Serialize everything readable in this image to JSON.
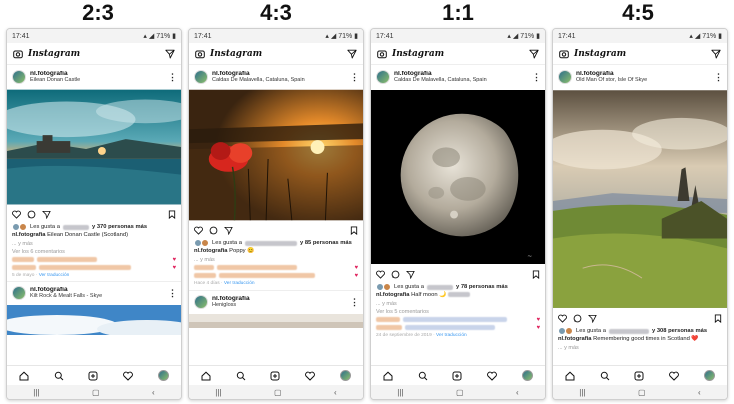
{
  "labels": [
    "2:3",
    "4:3",
    "1:1",
    "4:5"
  ],
  "brand": "Instagram",
  "colors": {
    "heart": "#e0245e",
    "link": "#3897f0",
    "divider": "#e6e6e6"
  },
  "phones": [
    {
      "status": {
        "time": "17:41",
        "battery": "71%"
      },
      "post": {
        "user": "nl.fotografia",
        "location": "Eilean Donan Castle",
        "likes_prefix": "Les gusta a",
        "likes_suffix": "y 370 personas más",
        "caption": "Eilean Donan Castle (Scotland)",
        "more": "... y más",
        "comments_link": "Ver los 6 comentarios",
        "meta": "5 de mayo ·",
        "meta_link": "Ver traducción"
      },
      "next": {
        "user": "nl.fotografia",
        "location": "Kilt Rock & Mealt Falls - Skye"
      }
    },
    {
      "status": {
        "time": "17:41",
        "battery": "71%"
      },
      "post": {
        "user": "nl.fotografia",
        "location": "Caldas De Malavella, Cataluna, Spain",
        "likes_prefix": "Les gusta a",
        "likes_suffix": "y 85 personas más",
        "caption": "Poppy",
        "more": "... y más",
        "meta": "Hace 4 días ·",
        "meta_link": "Ver traducción"
      },
      "next": {
        "user": "nl.fotografia",
        "location": "Henigloss"
      }
    },
    {
      "status": {
        "time": "17:41",
        "battery": "71%"
      },
      "post": {
        "user": "nl.fotografia",
        "location": "Caldas De Malavella, Cataluna, Spain",
        "likes_prefix": "Les gusta a",
        "likes_suffix": "y 78 personas más",
        "caption": "Half moon 🌙",
        "more": "... y más",
        "comments_link": "Ver los 5 comentarios",
        "meta": "24 de septiembre de 2019 ·",
        "meta_link": "Ver traducción"
      }
    },
    {
      "status": {
        "time": "17:41",
        "battery": "71%"
      },
      "post": {
        "user": "nl.fotografia",
        "location": "Old Man Of stor, Isle Of Skye",
        "likes_prefix": "Les gusta a",
        "likes_suffix": "y 308 personas más",
        "caption": "Remembering good times in Scotland ❤️",
        "more": "... y más"
      }
    }
  ]
}
